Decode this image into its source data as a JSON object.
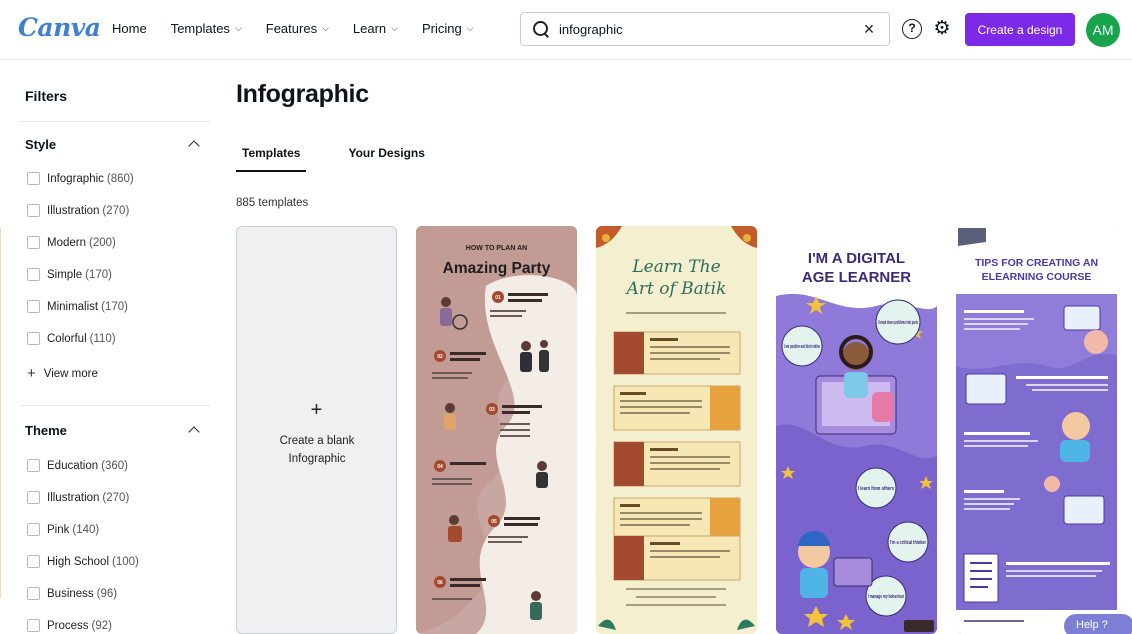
{
  "brand": {
    "logo": "Canva",
    "accent": "#7d2ae8",
    "avatar_bg": "#18a44d"
  },
  "nav": {
    "home": "Home",
    "templates": "Templates",
    "features": "Features",
    "learn": "Learn",
    "pricing": "Pricing"
  },
  "search": {
    "value": "infographic",
    "icon": "search-icon"
  },
  "header": {
    "create_label": "Create a design",
    "avatar_initials": "AM",
    "help_icon": "help-circle-icon",
    "settings_icon": "gear-icon"
  },
  "sidebar": {
    "title": "Filters",
    "style": {
      "heading": "Style",
      "items": [
        {
          "label": "Infographic",
          "count": "(860)"
        },
        {
          "label": "Illustration",
          "count": "(270)"
        },
        {
          "label": "Modern",
          "count": "(200)"
        },
        {
          "label": "Simple",
          "count": "(170)"
        },
        {
          "label": "Minimalist",
          "count": "(170)"
        },
        {
          "label": "Colorful",
          "count": "(110)"
        }
      ],
      "view_more": "View more"
    },
    "theme": {
      "heading": "Theme",
      "items": [
        {
          "label": "Education",
          "count": "(360)"
        },
        {
          "label": "Illustration",
          "count": "(270)"
        },
        {
          "label": "Pink",
          "count": "(140)"
        },
        {
          "label": "High School",
          "count": "(100)"
        },
        {
          "label": "Business",
          "count": "(96)"
        },
        {
          "label": "Process",
          "count": "(92)"
        }
      ]
    }
  },
  "main": {
    "title": "Infographic",
    "tabs": [
      "Templates",
      "Your Designs"
    ],
    "template_count": "885 templates",
    "blank_card": {
      "plus": "+",
      "line1": "Create a blank",
      "line2": "Infographic"
    },
    "cards": [
      {
        "top": "HOW TO PLAN AN",
        "title": "Amazing Party",
        "steps": [
          "01",
          "02",
          "03",
          "04",
          "05",
          "06"
        ],
        "bg": "#c8a7a2"
      },
      {
        "title_l1": "Learn The",
        "title_l2": "Art of Batik",
        "bg": "#f3efcf"
      },
      {
        "title_l1": "I'M A DIGITAL",
        "title_l2": "AGE LEARNER",
        "bubbles": [
          "I am positive and kind online",
          "I break down problems into parts",
          "I learn from others",
          "I'm a critical thinker",
          "I manage my behaviour"
        ],
        "bg": "#8f79d9"
      },
      {
        "title_l1": "TIPS FOR CREATING AN",
        "title_l2": "ELEARNING COURSE",
        "bg": "#7e6ccf"
      }
    ]
  },
  "help": {
    "label": "Help ?"
  }
}
